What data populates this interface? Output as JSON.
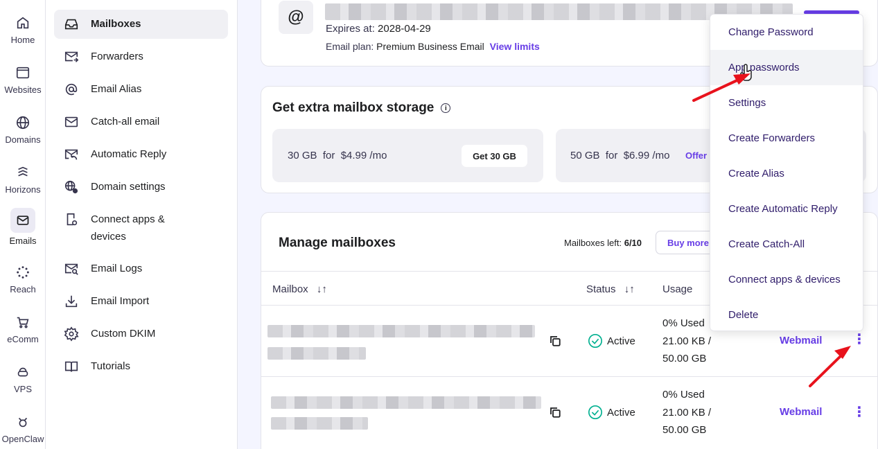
{
  "rail": [
    {
      "label": "Home",
      "icon": "home-icon"
    },
    {
      "label": "Websites",
      "icon": "browser-window-icon"
    },
    {
      "label": "Domains",
      "icon": "globe-icon"
    },
    {
      "label": "Horizons",
      "icon": "waves-icon"
    },
    {
      "label": "Emails",
      "icon": "envelope-icon"
    },
    {
      "label": "Reach",
      "icon": "burst-icon"
    },
    {
      "label": "eComm",
      "icon": "cart-icon"
    },
    {
      "label": "VPS",
      "icon": "cloud-server-icon"
    },
    {
      "label": "OpenClaw",
      "icon": "claw-icon"
    }
  ],
  "subnav": [
    {
      "label": "Mailboxes",
      "icon": "inbox-icon"
    },
    {
      "label": "Forwarders",
      "icon": "forward-mail-icon"
    },
    {
      "label": "Email Alias",
      "icon": "at-sign-icon"
    },
    {
      "label": "Catch-all email",
      "icon": "envelope-icon"
    },
    {
      "label": "Automatic Reply",
      "icon": "auto-reply-icon"
    },
    {
      "label": "Domain settings",
      "icon": "globe-gear-icon"
    },
    {
      "label": "Connect apps & devices",
      "icon": "phone-link-icon"
    },
    {
      "label": "Email Logs",
      "icon": "mail-search-icon"
    },
    {
      "label": "Email Import",
      "icon": "download-icon"
    },
    {
      "label": "Custom DKIM",
      "icon": "gear-icon"
    },
    {
      "label": "Tutorials",
      "icon": "book-icon"
    }
  ],
  "account": {
    "at_symbol": "@",
    "expires_label": "Expires at:",
    "expires_value": "2028-04-29",
    "plan_label": "Email plan:",
    "plan_value": "Premium Business Email",
    "view_limits": "View limits"
  },
  "storage": {
    "title": "Get extra mailbox storage",
    "offers": [
      {
        "text": "30 GB  for  $4.99 /mo",
        "button": "Get 30 GB"
      },
      {
        "text": "50 GB  for  $6.99 /mo",
        "badge": "Offer"
      }
    ]
  },
  "manage": {
    "title": "Manage mailboxes",
    "left_label": "Mailboxes left:",
    "left_value": "6/10",
    "buy_more": "Buy more",
    "columns": {
      "mailbox": "Mailbox",
      "status": "Status",
      "usage": "Usage"
    },
    "sort_glyph": "↓↑",
    "rows": [
      {
        "status": "Active",
        "usage_pct": "0% Used",
        "usage_size": "21.00 KB /",
        "usage_total": "50.00 GB",
        "action": "Webmail"
      },
      {
        "status": "Active",
        "usage_pct": "0% Used",
        "usage_size": "21.00 KB /",
        "usage_total": "50.00 GB",
        "action": "Webmail"
      }
    ]
  },
  "dropdown": [
    "Change Password",
    "App passwords",
    "Settings",
    "Create Forwarders",
    "Create Alias",
    "Create Automatic Reply",
    "Create Catch-All",
    "Connect apps & devices",
    "Delete"
  ],
  "colors": {
    "accent": "#673de6",
    "arrow": "#e8121c"
  }
}
